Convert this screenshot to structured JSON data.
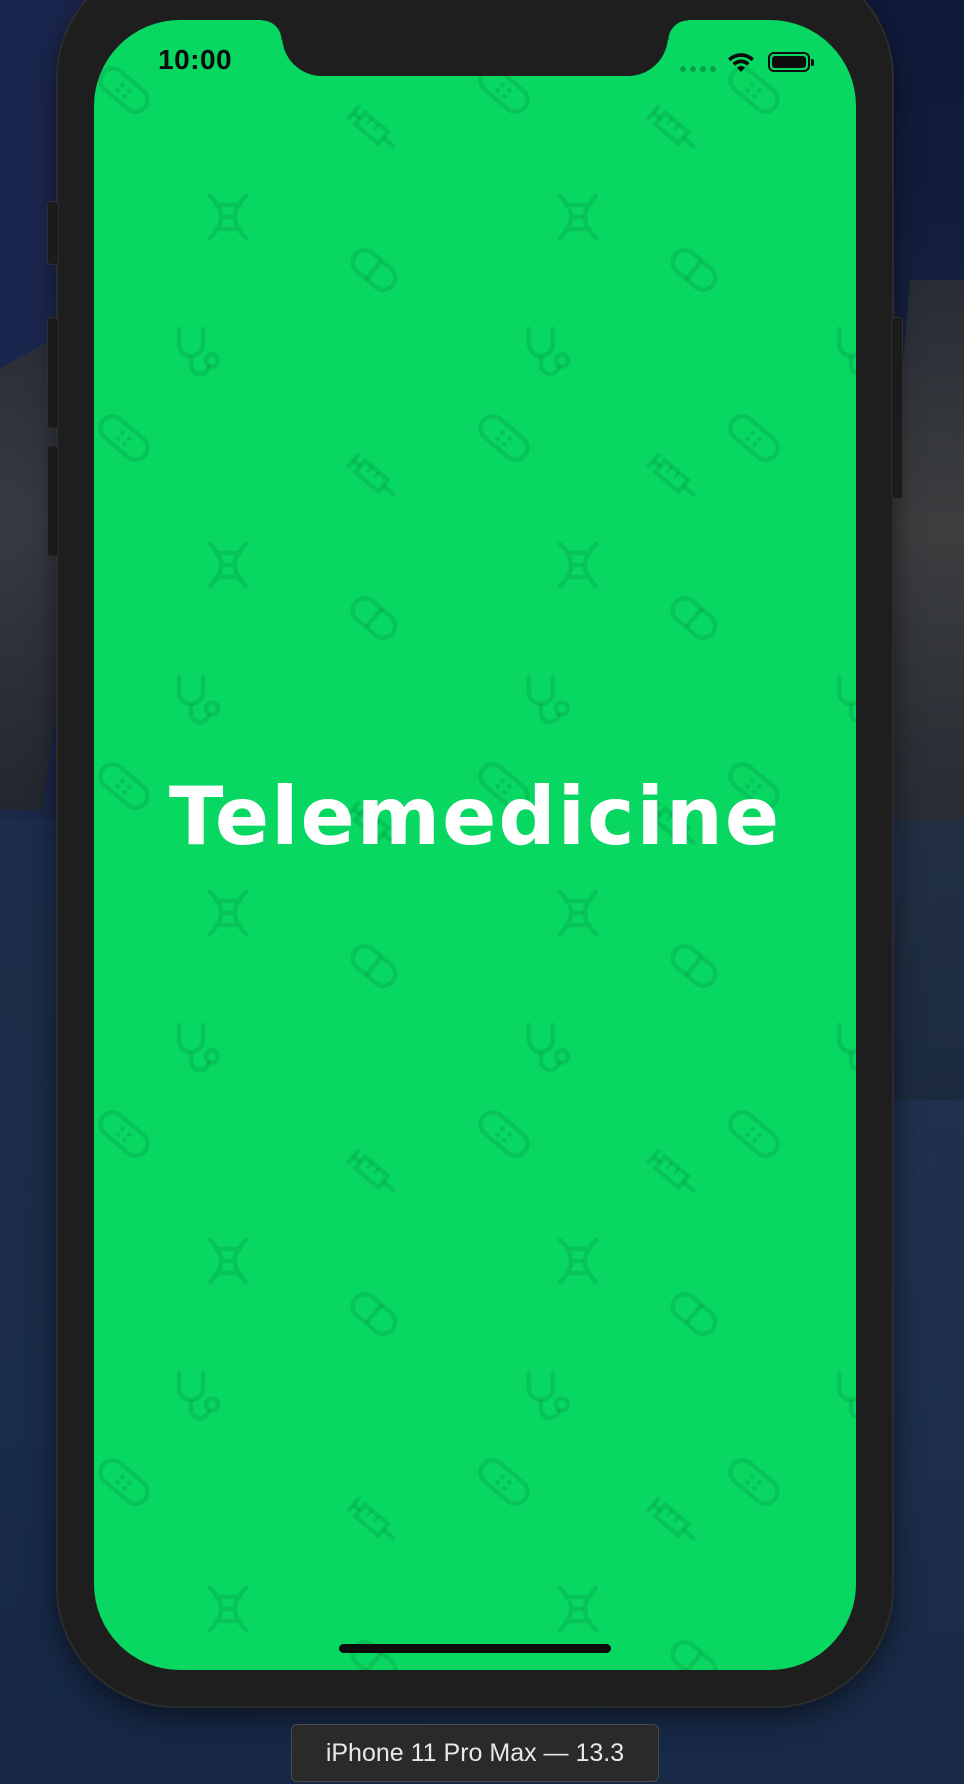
{
  "status_bar": {
    "time": "10:00",
    "wifi_icon": "wifi-icon",
    "battery_icon": "battery-icon",
    "battery_level": 1.0
  },
  "app": {
    "title": "Telemedicine",
    "background_color": "#08d762",
    "title_color": "#ffffff",
    "pattern_icons": [
      "dna-icon",
      "pill-icon",
      "stethoscope-icon",
      "bandage-icon",
      "syringe-icon"
    ]
  },
  "simulator": {
    "device_label": "iPhone 11 Pro Max — 13.3"
  }
}
